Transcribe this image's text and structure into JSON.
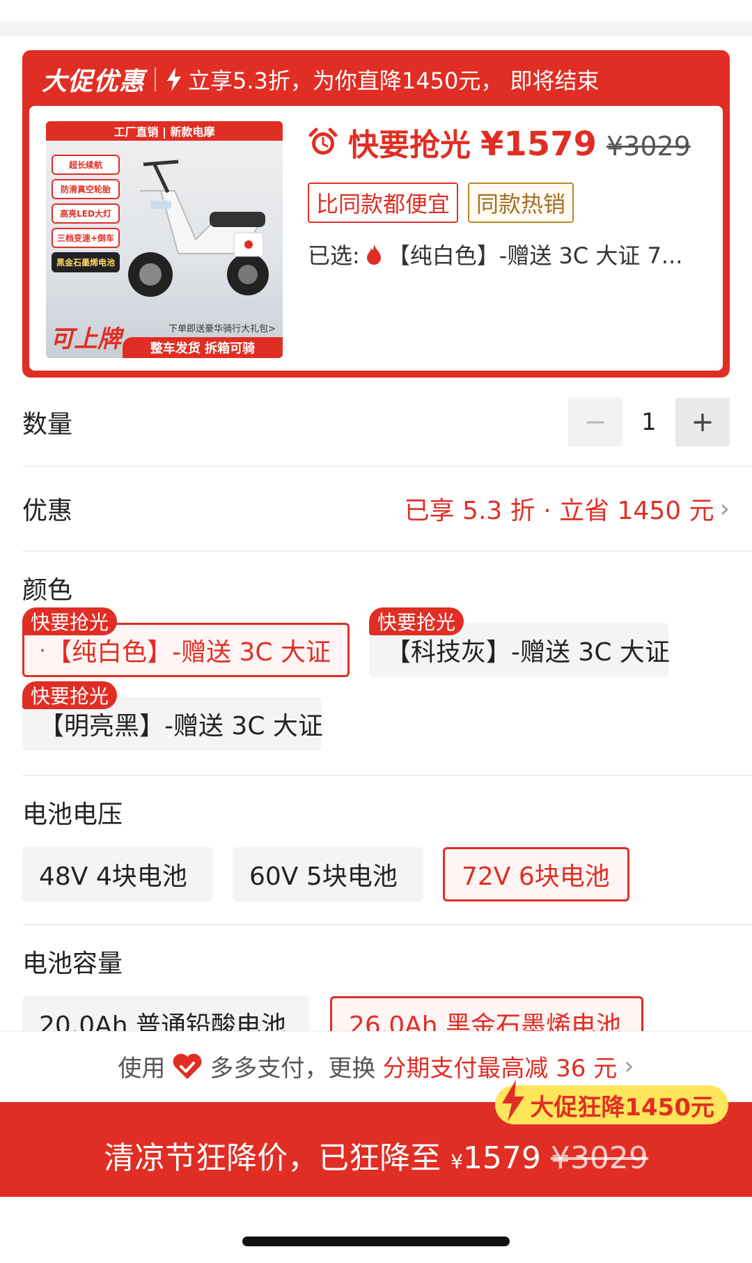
{
  "promo": {
    "tag": "大促优惠",
    "headline": "立享5.3折，为你直降1450元，  即将结束",
    "image": {
      "banner": "工厂直销 | 新款电摩",
      "chip1": "超长续航",
      "chip2": "防滑真空轮胎",
      "chip3": "高亮LED大灯",
      "chip4": "三档变速+倒车",
      "chip5": "黑金石墨烯电池",
      "badge": "可上牌",
      "note": "下单即送豪华骑行大礼包>",
      "ribbon": "整车发货  拆箱可骑"
    },
    "price_label": "快要抢光",
    "price_now": "¥1579",
    "price_old": "¥3029",
    "tags": [
      "比同款都便宜",
      "同款热销"
    ],
    "selected_prefix": "已选:",
    "selected_value": "【纯白色】-赠送 3C 大证 7..."
  },
  "quantity": {
    "label": "数量",
    "value": "1",
    "minus": "−",
    "plus": "+"
  },
  "discount": {
    "label": "优惠",
    "value": "已享 5.3 折 · 立省 1450 元",
    "chevron": "›"
  },
  "color": {
    "title": "颜色",
    "hot_badge": "快要抢光",
    "options": [
      "【纯白色】-赠送 3C 大证",
      "【科技灰】-赠送 3C 大证",
      "【明亮黑】-赠送 3C 大证"
    ]
  },
  "voltage": {
    "title": "电池电压",
    "options": [
      "48V 4块电池",
      "60V 5块电池",
      "72V 6块电池"
    ]
  },
  "capacity": {
    "title": "电池容量",
    "options": [
      "20.0Ah 普通铅酸电池",
      "26.0Ah 黑金石墨烯电池"
    ]
  },
  "pay": {
    "prefix": "使用",
    "method": "多多支付，更换",
    "highlight": "分期支付最高减 36 元",
    "chevron": "›"
  },
  "cta": {
    "bubble": "大促狂降1450元",
    "text": "清凉节狂降价，已狂降至 ",
    "currency": "¥",
    "price": "1579 ",
    "old_price": "¥3029"
  },
  "colors": {
    "accent": "#e02e24",
    "gold": "#ffe55a"
  }
}
